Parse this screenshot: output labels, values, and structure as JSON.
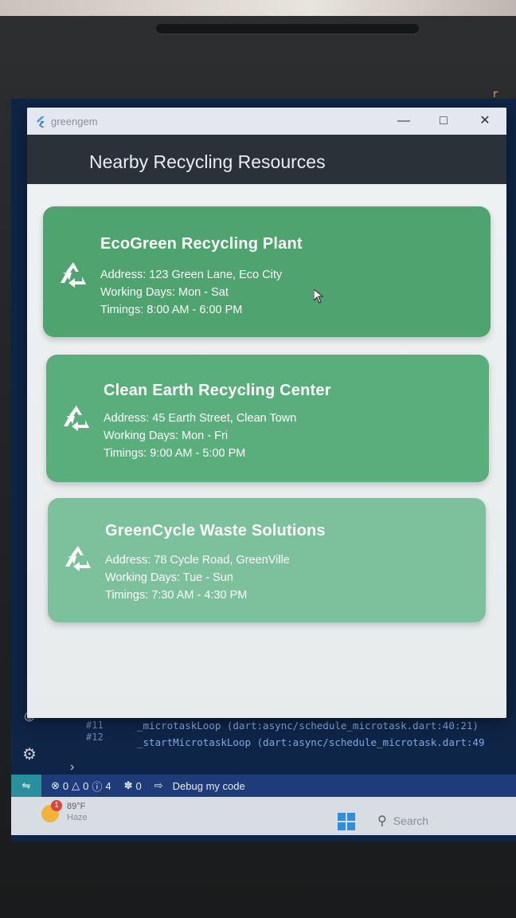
{
  "app": {
    "title": "greengem",
    "header": "Nearby Recycling Resources"
  },
  "resources": [
    {
      "name": "EcoGreen Recycling Plant",
      "address": "Address: 123 Green Lane, Eco City",
      "days": "Working Days: Mon - Sat",
      "timings": "Timings: 8:00 AM - 6:00 PM",
      "color": "#4fa36e"
    },
    {
      "name": "Clean Earth Recycling Center",
      "address": "Address: 45 Earth Street, Clean Town",
      "days": "Working Days: Mon - Fri",
      "timings": "Timings: 9:00 AM - 5:00 PM",
      "color": "#5aae7c"
    },
    {
      "name": "GreenCycle Waste Solutions",
      "address": "Address: 78 Cycle Road, GreenVille",
      "days": "Working Days: Tue - Sun",
      "timings": "Timings: 7:30 AM - 4:30 PM",
      "color": "#7dc09c"
    }
  ],
  "ide": {
    "console": [
      {
        "num": "#11",
        "text": "_microtaskLoop (dart:async/schedule_microtask.dart:40:21)"
      },
      {
        "num": "#12",
        "text": "_startMicrotaskLoop (dart:async/schedule_microtask.dart:49"
      }
    ],
    "status": {
      "errors": "0",
      "warnings": "0",
      "info": "4",
      "ports": "0",
      "debug": "Debug my code"
    }
  },
  "taskbar": {
    "weather_badge": "1",
    "temperature": "89°F",
    "condition": "Haze",
    "search": "Search"
  }
}
